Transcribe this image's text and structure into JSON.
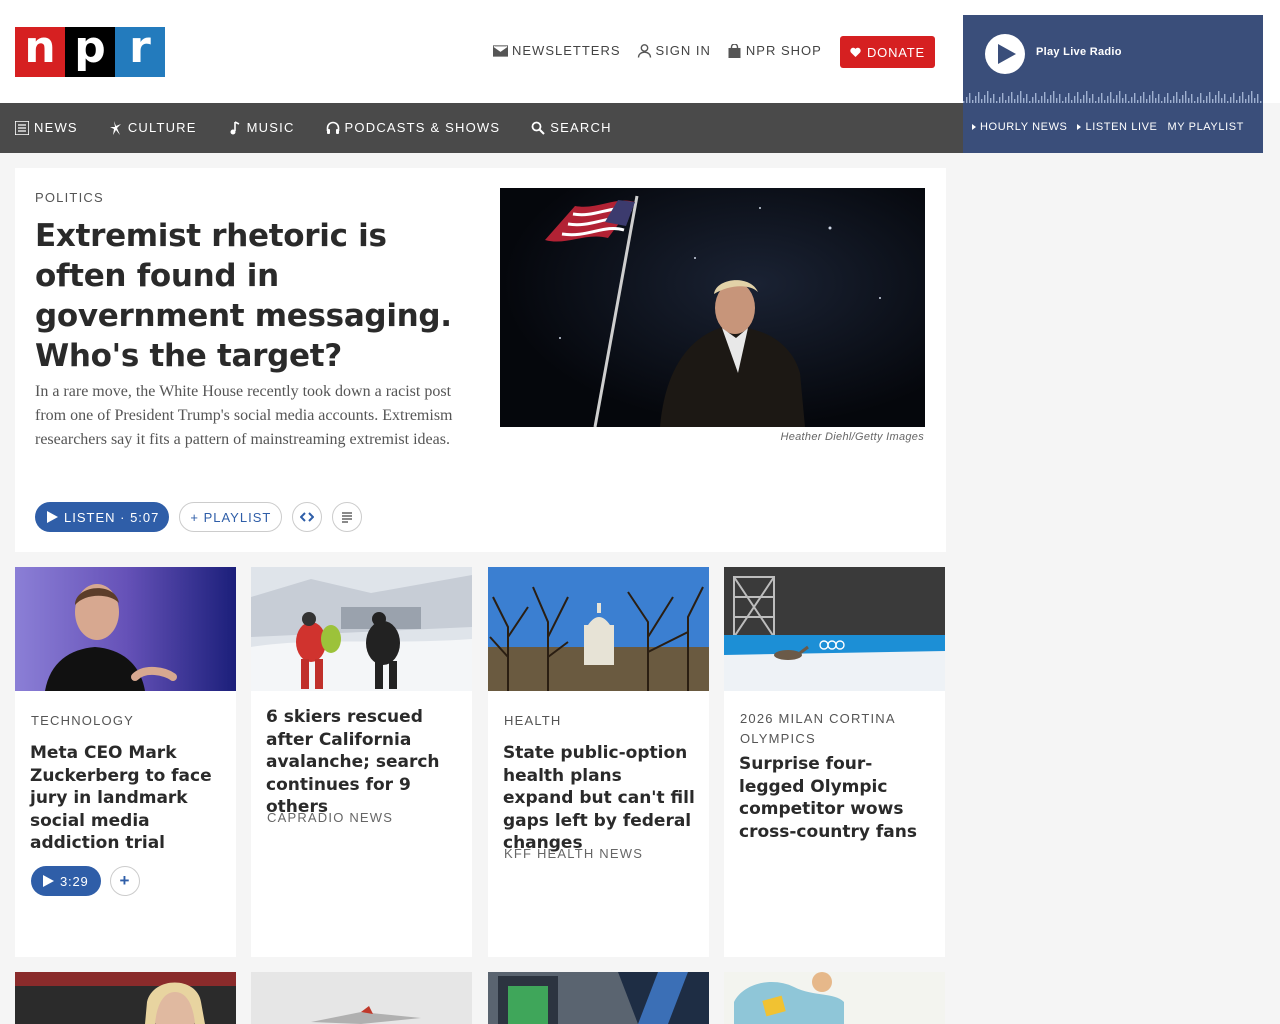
{
  "logo": {
    "letters": [
      "n",
      "p",
      "r"
    ]
  },
  "utility_nav": [
    {
      "label": "NEWSLETTERS",
      "icon": "mail-icon"
    },
    {
      "label": "SIGN IN",
      "icon": "user-icon"
    },
    {
      "label": "NPR SHOP",
      "icon": "shopping-bag-icon"
    }
  ],
  "donate": {
    "label": "DONATE",
    "icon": "heart-icon"
  },
  "player": {
    "title": "Play Live Radio",
    "links": [
      "HOURLY NEWS",
      "LISTEN LIVE",
      "MY PLAYLIST"
    ]
  },
  "main_nav": [
    {
      "label": "NEWS",
      "icon": "newspaper-icon"
    },
    {
      "label": "CULTURE",
      "icon": "culture-icon"
    },
    {
      "label": "MUSIC",
      "icon": "music-note-icon"
    },
    {
      "label": "PODCASTS & SHOWS",
      "icon": "headphones-icon"
    },
    {
      "label": "SEARCH",
      "icon": "search-icon"
    }
  ],
  "lead": {
    "eyebrow": "POLITICS",
    "title": "Extremist rhetoric is often found in government messaging. Who's the target?",
    "teaser": "In a rare move, the White House recently took down a racist post from one of President Trump's social media accounts. Extremism researchers say it fits a pattern of mainstreaming extremist ideas.",
    "image_credit": "Heather Diehl/Getty Images",
    "listen_label": "LISTEN · 5:07",
    "playlist_label": "+ PLAYLIST"
  },
  "cards": [
    {
      "eyebrow": "TECHNOLOGY",
      "title": "Meta CEO Mark Zuckerberg to face jury in landmark social media addiction trial",
      "source": "",
      "audio_label": "3:29",
      "plus_label": "+"
    },
    {
      "eyebrow": "",
      "title": "6 skiers rescued after California avalanche; search continues for 9 others",
      "source": "CAPRADIO NEWS"
    },
    {
      "eyebrow": "HEALTH",
      "title": "State public-option health plans expand but can't fill gaps left by federal changes",
      "source": "KFF HEALTH NEWS"
    },
    {
      "eyebrow": "2026 MILAN CORTINA OLYMPICS",
      "title": "Surprise four-legged Olympic competitor wows cross-country fans",
      "source": ""
    }
  ],
  "colors": {
    "npr_red": "#d62021",
    "npr_black": "#000000",
    "npr_blue": "#237bbd",
    "nav_bg": "#4a4a4a",
    "player_bg": "#3a4e7a",
    "action_blue": "#2f5ea8"
  }
}
